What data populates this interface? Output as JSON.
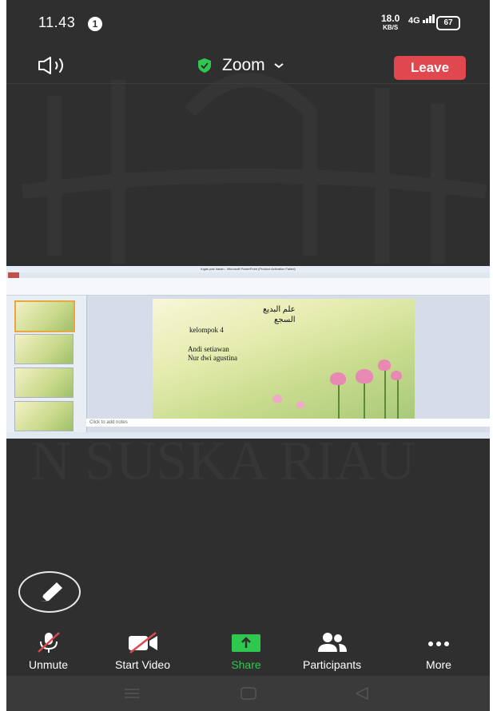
{
  "status_bar": {
    "time": "11.43",
    "notification_count": "1",
    "net_speed": "18.0",
    "net_speed_unit": "KB/S",
    "signal": "4G",
    "battery": "67"
  },
  "top_bar": {
    "title": "Zoom",
    "leave_label": "Leave"
  },
  "shared_screen": {
    "window_title": "tugas pak hasan - Microsoft PowerPoint (Product Activation Failed)",
    "slide": {
      "arabic_line1": "علم البديع",
      "arabic_line2": "السجع",
      "group": "kelompok 4",
      "member1": "Andi setiawan",
      "member2": "Nur dwi agustina"
    },
    "notes_placeholder": "Click to add notes"
  },
  "toolbar": {
    "unmute": "Unmute",
    "start_video": "Start Video",
    "share": "Share",
    "participants": "Participants",
    "more": "More"
  },
  "colors": {
    "background": "#2f2f2f",
    "leave": "#e0474f",
    "share": "#2fc84e",
    "shield": "#2fc84e"
  },
  "icons": [
    "speaker-icon",
    "shield-icon",
    "chevron-down-icon",
    "pen-icon",
    "mic-off-icon",
    "video-off-icon",
    "share-icon",
    "participants-icon",
    "more-icon"
  ]
}
